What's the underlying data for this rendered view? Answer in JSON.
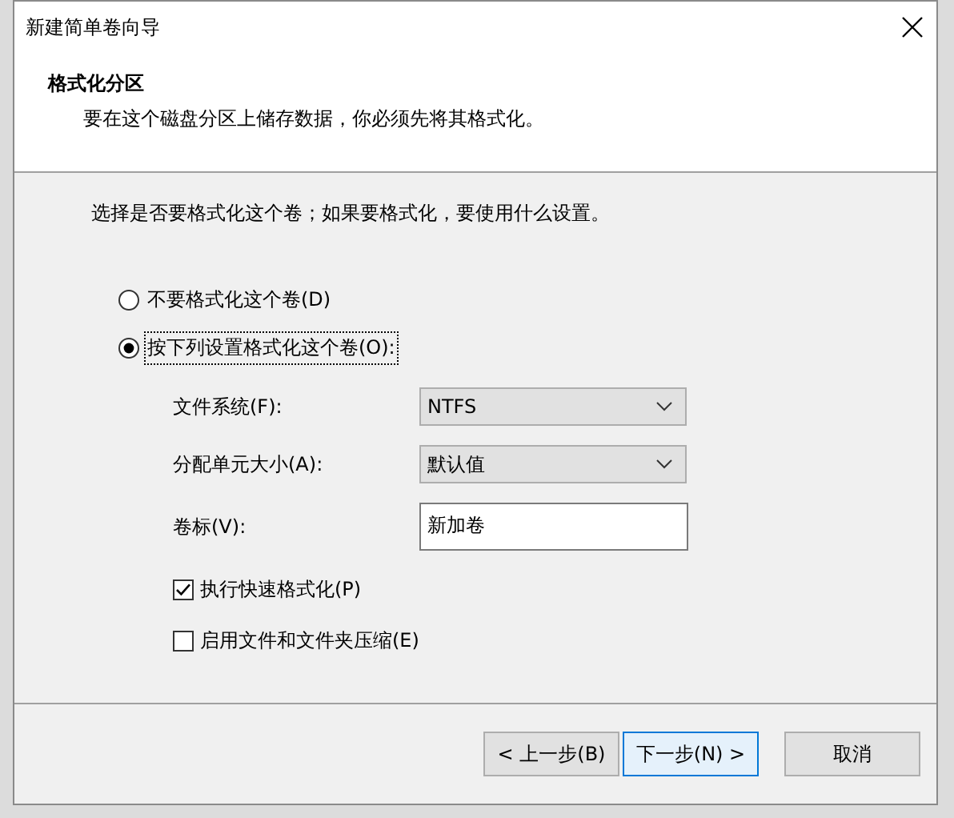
{
  "window": {
    "title": "新建简单卷向导"
  },
  "header": {
    "title": "格式化分区",
    "subtitle": "要在这个磁盘分区上储存数据，你必须先将其格式化。"
  },
  "prompt": "选择是否要格式化这个卷；如果要格式化，要使用什么设置。",
  "options": [
    {
      "label": "不要格式化这个卷(D)",
      "selected": false,
      "focused": false
    },
    {
      "label": "按下列设置格式化这个卷(O):",
      "selected": true,
      "focused": true
    }
  ],
  "fields": [
    {
      "kind": "dropdown",
      "label": "文件系统(F):",
      "value": "NTFS"
    },
    {
      "kind": "dropdown",
      "label": "分配单元大小(A):",
      "value": "默认值"
    },
    {
      "kind": "text",
      "label": "卷标(V):",
      "value": "新加卷"
    }
  ],
  "checkboxes": [
    {
      "label": "执行快速格式化(P)",
      "checked": true
    },
    {
      "label": "启用文件和文件夹压缩(E)",
      "checked": false
    }
  ],
  "buttons": [
    {
      "label": "< 上一步(B)",
      "default": false
    },
    {
      "label": "下一步(N) >",
      "default": true
    },
    {
      "label": "取消",
      "default": false
    }
  ]
}
